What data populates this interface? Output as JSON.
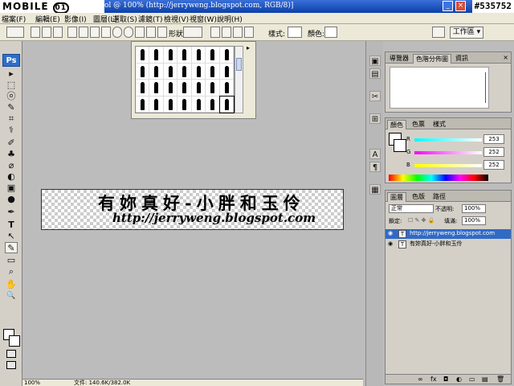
{
  "window": {
    "title": "ol @ 100% (http://jerryweng.blogspot.com, RGB/8)]",
    "watermark": "MOBILE",
    "watermark_badge": "01",
    "image_id": "#535752",
    "min_label": "_",
    "close_label": "×"
  },
  "menu": [
    "檔案(F)",
    "編輯(E)",
    "影像(I)",
    "圖層(L)",
    "選取(S)",
    "濾鏡(T)",
    "檢視(V)",
    "視窗(W)",
    "說明(H)"
  ],
  "options": {
    "shape_label": "形狀:",
    "style_label": "樣式:",
    "color_label": "顏色:",
    "workspace_label": "工作區 ▾"
  },
  "toolbox": {
    "ps_label": "Ps",
    "tools": [
      "▸",
      "⬚",
      "ⓞ",
      "✎",
      "⌗",
      "⚕",
      "✐",
      "♣",
      "⌀",
      "◐",
      "▣",
      "●",
      "✒",
      "T",
      "↖",
      "✎",
      "▭",
      "⌕",
      "✋",
      "🔍"
    ]
  },
  "picker": {
    "arrow": "▸"
  },
  "document": {
    "line1": "有妳真好-小胖和玉伶",
    "line2": "http://jerryweng.blogspot.com"
  },
  "status": {
    "zoom": "100%",
    "doc_size": "文件: 140.6K/382.0K"
  },
  "dock": [
    "▣",
    "▤",
    "✂",
    "⊞",
    "A",
    "¶",
    "▦"
  ],
  "panel_nav": {
    "tabs": [
      "導覽器",
      "色階分佈圖",
      "資訊"
    ],
    "close": "×"
  },
  "panel_color": {
    "tabs": [
      "顏色",
      "色票",
      "樣式"
    ],
    "channels": [
      {
        "label": "R",
        "value": "253",
        "gradient": "#00ffff"
      },
      {
        "label": "G",
        "value": "252",
        "gradient": "#ff00ff"
      },
      {
        "label": "B",
        "value": "252",
        "gradient": "#ffff00"
      }
    ]
  },
  "panel_layers": {
    "tabs": [
      "圖層",
      "色版",
      "路徑"
    ],
    "blend_mode": "正常",
    "opacity_label": "不透明:",
    "opacity_value": "100%",
    "lock_label": "鎖定:",
    "fill_label": "填滿:",
    "fill_value": "100%",
    "layers": [
      {
        "name": "http://jerryweng.blogspot.com",
        "selected": true
      },
      {
        "name": "有妳真好-小胖和玉伶",
        "selected": false
      }
    ],
    "footer_icons": [
      "∞",
      "fx",
      "◘",
      "◐",
      "▭",
      "▤",
      "🗑"
    ]
  }
}
